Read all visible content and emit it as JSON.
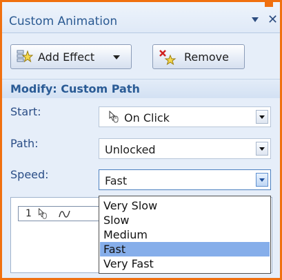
{
  "pane": {
    "title": "Custom Animation"
  },
  "toolbar": {
    "add_effect_label": "Add Effect",
    "remove_label": "Remove"
  },
  "modify": {
    "header": "Modify: Custom Path",
    "start_label": "Start:",
    "start_value": "On Click",
    "path_label": "Path:",
    "path_value": "Unlocked",
    "speed_label": "Speed:",
    "speed_value": "Fast"
  },
  "speed_options": [
    "Very Slow",
    "Slow",
    "Medium",
    "Fast",
    "Very Fast"
  ],
  "speed_selected": "Fast",
  "effect_list": {
    "item_number": "1"
  },
  "colors": {
    "frame_border": "#f07010",
    "header_text": "#2a5b95",
    "selection": "#86aeea"
  }
}
